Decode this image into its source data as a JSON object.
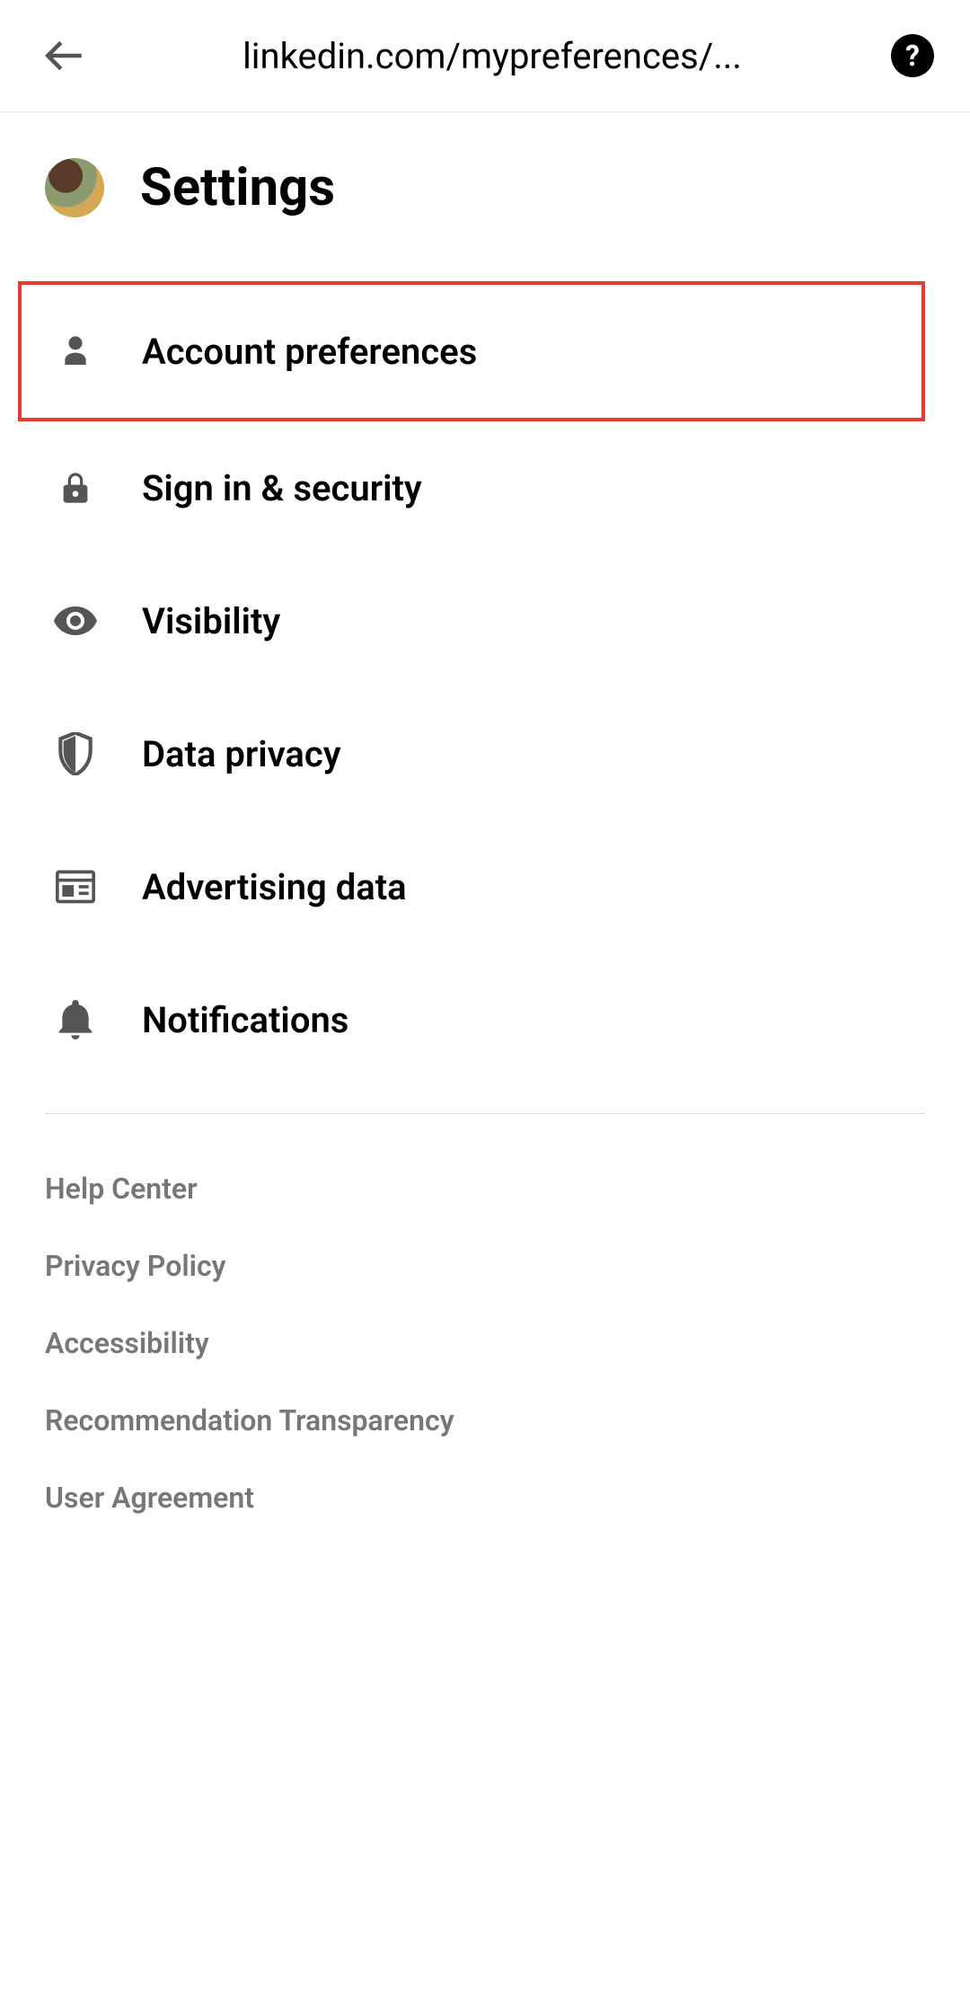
{
  "topbar": {
    "url": "linkedin.com/mypreferences/..."
  },
  "header": {
    "title": "Settings"
  },
  "nav": {
    "items": [
      {
        "label": "Account preferences",
        "icon": "person-icon",
        "highlighted": true
      },
      {
        "label": "Sign in & security",
        "icon": "lock-icon",
        "highlighted": false
      },
      {
        "label": "Visibility",
        "icon": "eye-icon",
        "highlighted": false
      },
      {
        "label": "Data privacy",
        "icon": "shield-icon",
        "highlighted": false
      },
      {
        "label": "Advertising data",
        "icon": "newspaper-icon",
        "highlighted": false
      },
      {
        "label": "Notifications",
        "icon": "bell-icon",
        "highlighted": false
      }
    ]
  },
  "footer": {
    "items": [
      {
        "label": "Help Center"
      },
      {
        "label": "Privacy Policy"
      },
      {
        "label": "Accessibility"
      },
      {
        "label": "Recommendation Transparency"
      },
      {
        "label": "User Agreement"
      }
    ]
  },
  "colors": {
    "highlight_border": "#e53935",
    "icon_fill": "#555555",
    "footer_text": "#777777"
  }
}
